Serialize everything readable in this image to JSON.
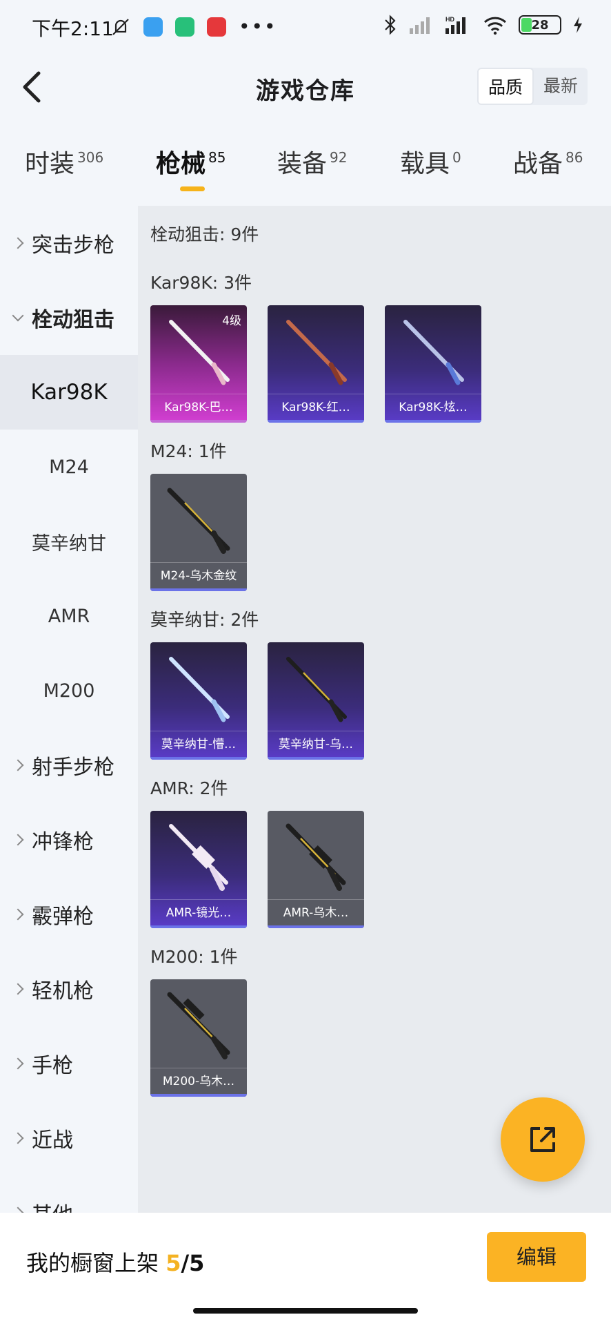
{
  "status_bar": {
    "time": "下午2:11",
    "battery": "28"
  },
  "header": {
    "title": "游戏仓库",
    "sort_options": [
      "品质",
      "最新"
    ]
  },
  "tabs": [
    {
      "label": "时装",
      "count": "306"
    },
    {
      "label": "枪械",
      "count": "85"
    },
    {
      "label": "装备",
      "count": "92"
    },
    {
      "label": "载具",
      "count": "0"
    },
    {
      "label": "战备",
      "count": "86"
    }
  ],
  "sidebar": [
    {
      "label": "突击步枪"
    },
    {
      "label": "栓动狙击"
    },
    {
      "label": "Kar98K"
    },
    {
      "label": "M24"
    },
    {
      "label": "莫辛纳甘"
    },
    {
      "label": "AMR"
    },
    {
      "label": "M200"
    },
    {
      "label": "射手步枪"
    },
    {
      "label": "冲锋枪"
    },
    {
      "label": "霰弹枪"
    },
    {
      "label": "轻机枪"
    },
    {
      "label": "手枪"
    },
    {
      "label": "近战"
    },
    {
      "label": "其他"
    }
  ],
  "main": {
    "category_total": "栓动狙击: 9件",
    "groups": [
      {
        "title": "Kar98K: 3件",
        "items": [
          {
            "name": "Kar98K-巴…",
            "level": "4级",
            "color": "#d33fd3"
          },
          {
            "name": "Kar98K-红…",
            "color": "#5a3cc9"
          },
          {
            "name": "Kar98K-炫…",
            "color": "#5a3cc9"
          }
        ]
      },
      {
        "title": "M24: 1件",
        "items": [
          {
            "name": "M24-乌木金纹",
            "color": "#585a63"
          }
        ]
      },
      {
        "title": "莫辛纳甘: 2件",
        "items": [
          {
            "name": "莫辛纳甘-懵…",
            "color": "#5a3cc9"
          },
          {
            "name": "莫辛纳甘-乌…",
            "color": "#5a3cc9"
          }
        ]
      },
      {
        "title": "AMR: 2件",
        "items": [
          {
            "name": "AMR-镜光…",
            "color": "#5a3cc9"
          },
          {
            "name": "AMR-乌木…",
            "color": "#585a63"
          }
        ]
      },
      {
        "title": "M200: 1件",
        "items": [
          {
            "name": "M200-乌木…",
            "color": "#585a63"
          }
        ]
      }
    ]
  },
  "fab": {
    "icon": "share-out-icon"
  },
  "bottom": {
    "label": "我的橱窗上架",
    "current": "5",
    "total": "/5",
    "edit_label": "编辑"
  }
}
